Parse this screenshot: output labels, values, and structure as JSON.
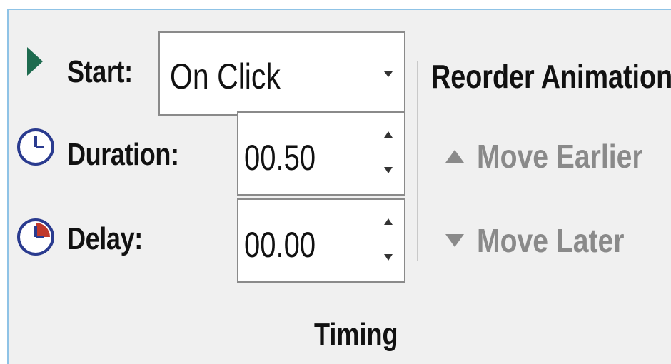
{
  "timing": {
    "start_label": "Start:",
    "start_value": "On Click",
    "duration_label": "Duration:",
    "duration_value": "00.50",
    "delay_label": "Delay:",
    "delay_value": "00.00",
    "group_label": "Timing"
  },
  "reorder": {
    "title": "Reorder Animation",
    "move_earlier": "Move Earlier",
    "move_later": "Move Later"
  },
  "icons": {
    "start": "play-triangle-icon",
    "duration": "clock-icon",
    "delay": "delay-clock-icon",
    "move_earlier": "triangle-up-icon",
    "move_later": "triangle-down-icon"
  },
  "colors": {
    "accent_border": "#8fc3e6",
    "play_green": "#1e6b4f",
    "clock_blue": "#2a3b8f",
    "delay_red": "#c0392b",
    "disabled_text": "#8a8a8a"
  }
}
